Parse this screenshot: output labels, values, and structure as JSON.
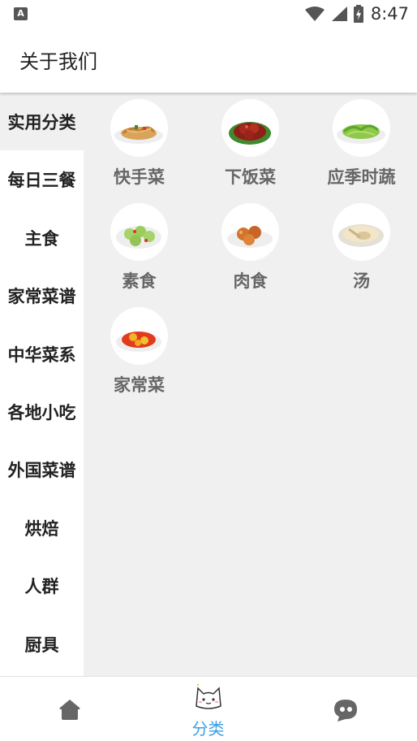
{
  "status_bar": {
    "app_icon_letter": "A",
    "time": "8:47"
  },
  "app_bar": {
    "title": "关于我们"
  },
  "sidebar": {
    "active_index": 0,
    "items": [
      {
        "label": "实用分类"
      },
      {
        "label": "每日三餐"
      },
      {
        "label": "主食"
      },
      {
        "label": "家常菜谱"
      },
      {
        "label": "中华菜系"
      },
      {
        "label": "各地小吃"
      },
      {
        "label": "外国菜谱"
      },
      {
        "label": "烘焙"
      },
      {
        "label": "人群"
      },
      {
        "label": "厨具"
      }
    ]
  },
  "categories": [
    {
      "label": "快手菜",
      "icon": "fried-noodles-dish-icon"
    },
    {
      "label": "下饭菜",
      "icon": "braised-meat-dish-icon"
    },
    {
      "label": "应季时蔬",
      "icon": "green-vegetable-dish-icon"
    },
    {
      "label": "素食",
      "icon": "cucumber-salad-dish-icon"
    },
    {
      "label": "肉食",
      "icon": "fried-chicken-dish-icon"
    },
    {
      "label": "汤",
      "icon": "soup-bowl-icon"
    },
    {
      "label": "家常菜",
      "icon": "tomato-egg-dish-icon"
    }
  ],
  "bottom_nav": {
    "tabs": [
      {
        "label": "",
        "icon": "home-icon"
      },
      {
        "label": "分类",
        "icon": "cat-face-icon",
        "active": true
      },
      {
        "label": "",
        "icon": "chat-bubble-icon"
      }
    ]
  },
  "colors": {
    "accent": "#3a9fe5",
    "background": "#f0f0f0",
    "icon_gray": "#666666"
  }
}
